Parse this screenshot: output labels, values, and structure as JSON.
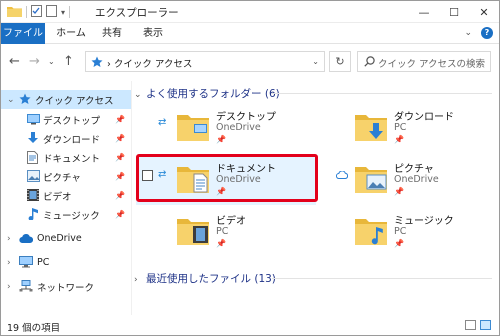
{
  "window": {
    "title": "エクスプローラー"
  },
  "ribbon": {
    "tabs": [
      "ファイル",
      "ホーム",
      "共有",
      "表示"
    ]
  },
  "address": {
    "path": "クイック アクセス",
    "search_placeholder": "クイック アクセスの検索"
  },
  "nav": {
    "quick_access": "クイック アクセス",
    "pinned": [
      "デスクトップ",
      "ダウンロード",
      "ドキュメント",
      "ピクチャ",
      "ビデオ",
      "ミュージック"
    ],
    "onedrive": "OneDrive",
    "pc": "PC",
    "network": "ネットワーク"
  },
  "content": {
    "frequent_title": "よく使用するフォルダー",
    "frequent_count": "(6)",
    "folders": [
      {
        "name": "デスクトップ",
        "location": "OneDrive"
      },
      {
        "name": "ダウンロード",
        "location": "PC"
      },
      {
        "name": "ドキュメント",
        "location": "OneDrive"
      },
      {
        "name": "ピクチャ",
        "location": "OneDrive"
      },
      {
        "name": "ビデオ",
        "location": "PC"
      },
      {
        "name": "ミュージック",
        "location": "PC"
      }
    ],
    "recent_title": "最近使用したファイル",
    "recent_count": "(13)"
  },
  "status": {
    "items": "19 個の項目"
  },
  "colors": {
    "accent": "#1a6fc4",
    "highlight": "#e3001b",
    "selected_bg": "#cce8ff"
  }
}
